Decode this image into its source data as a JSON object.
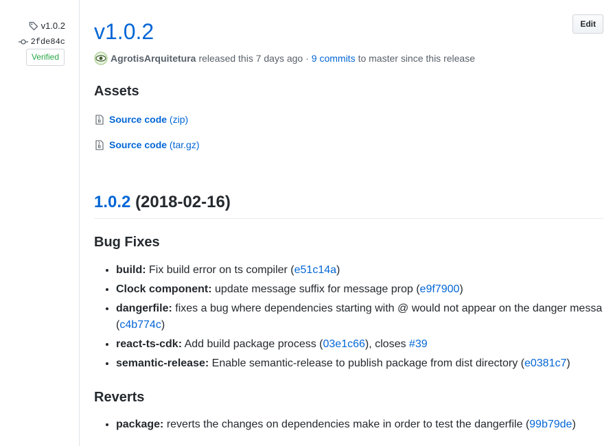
{
  "sidebar": {
    "tag": "v1.0.2",
    "commit": "2fde84c",
    "verified": "Verified"
  },
  "header": {
    "title": "v1.0.2",
    "edit_label": "Edit",
    "author": "AgrotisArquitetura",
    "released_text": "released this 7 days ago ·",
    "commits_link": "9 commits",
    "commits_suffix": "to master since this release"
  },
  "assets": {
    "heading": "Assets",
    "items": [
      {
        "name": "Source code",
        "format": "(zip)"
      },
      {
        "name": "Source code",
        "format": "(tar.gz)"
      }
    ]
  },
  "notes": {
    "version_link": "1.0.2",
    "version_date": "(2018-02-16)",
    "bug_fixes_heading": "Bug Fixes",
    "bug_fixes": [
      {
        "scope": "build:",
        "text": "Fix build error on ts compiler (",
        "hash": "e51c14a",
        "end": ")"
      },
      {
        "scope": "Clock component:",
        "text": "update message suffix for message prop (",
        "hash": "e9f7900",
        "end": ")"
      },
      {
        "scope": "dangerfile:",
        "text": "fixes a bug where dependencies starting with @ would not appear on the danger messa (",
        "hash": "c4b774c",
        "end": ")"
      },
      {
        "scope": "react-ts-cdk:",
        "text": "Add build package process (",
        "hash": "03e1c66",
        "mid": "), closes",
        "issue": "#39"
      },
      {
        "scope": "semantic-release:",
        "text": "Enable semantic-release to publish package from dist directory (",
        "hash": "e0381c7",
        "end": ")"
      }
    ],
    "reverts_heading": "Reverts",
    "reverts": [
      {
        "scope": "package:",
        "text": "reverts the changes on dependencies make in order to test the dangerfile (",
        "hash": "99b79de",
        "end": ")"
      }
    ]
  }
}
